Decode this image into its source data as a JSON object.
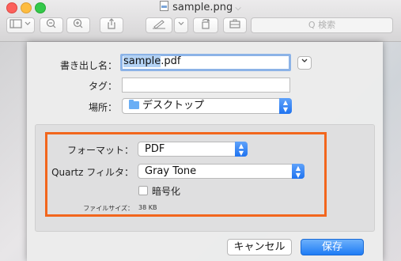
{
  "window": {
    "title": "sample.png",
    "title_chevron": "⌵",
    "search_placeholder": "Q 検索"
  },
  "toolbar": {
    "icons": [
      "sidebar-icon",
      "zoom-out-icon",
      "zoom-in-icon",
      "share-icon",
      "markup-icon",
      "rotate-icon",
      "toolbox-icon"
    ]
  },
  "save_dialog": {
    "export_as_label": "書き出し名：",
    "filename_base": "sample",
    "filename_ext": ".pdf",
    "expand_glyph": "⌄",
    "tags_label": "タグ：",
    "tags_value": "",
    "where_label": "場所：",
    "where_value": "デスクトップ"
  },
  "options": {
    "format_label": "フォーマット：",
    "format_value": "PDF",
    "quartz_label": "Quartz フィルタ：",
    "quartz_value": "Gray Tone",
    "encrypt_label": "暗号化",
    "encrypt_checked": false,
    "filesize_label": "ファイルサイズ：",
    "filesize_value": "38 KB"
  },
  "buttons": {
    "cancel": "キャンセル",
    "save": "保存"
  },
  "colors": {
    "accent": "#1f7cf5",
    "highlight_frame": "#f2661d"
  }
}
